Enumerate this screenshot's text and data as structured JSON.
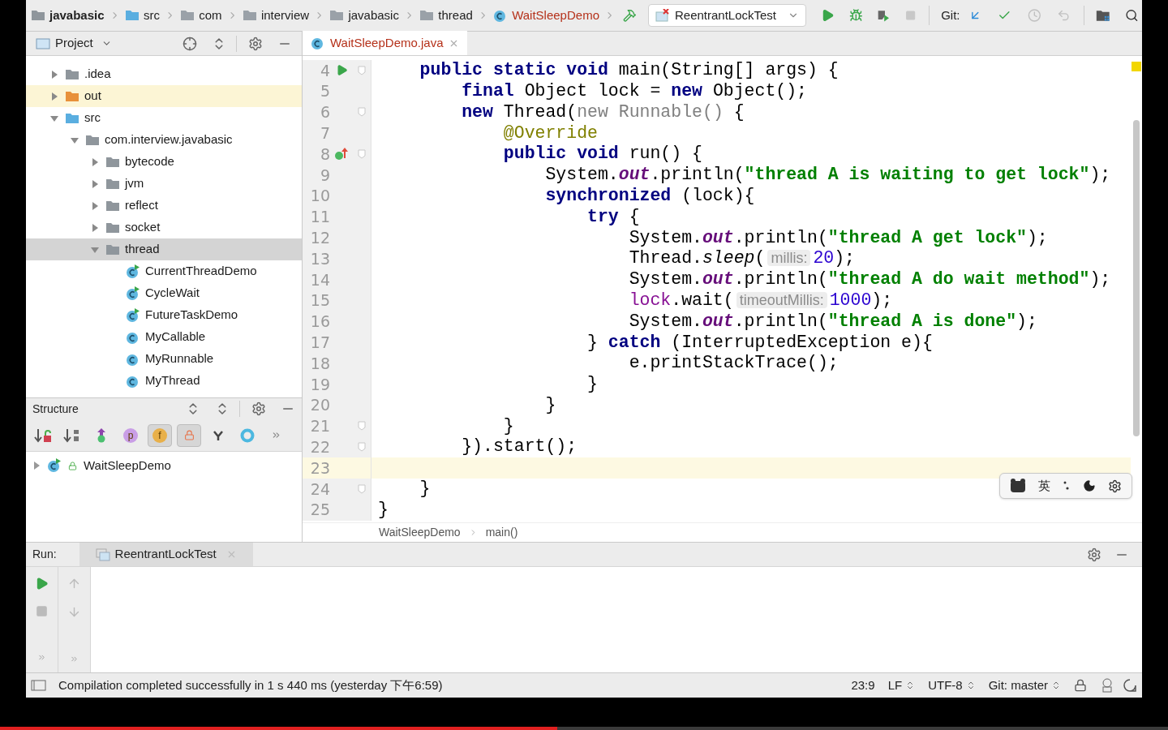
{
  "nav_bar": {
    "breadcrumbs": [
      {
        "label": "javabasic",
        "kind": "module"
      },
      {
        "label": "src",
        "kind": "source"
      },
      {
        "label": "com",
        "kind": "package"
      },
      {
        "label": "interview",
        "kind": "package"
      },
      {
        "label": "javabasic",
        "kind": "package"
      },
      {
        "label": "thread",
        "kind": "package"
      },
      {
        "label": "WaitSleepDemo",
        "kind": "class"
      }
    ],
    "run_config": "ReentrantLockTest",
    "git_label": "Git:"
  },
  "project_panel": {
    "title": "Project",
    "tree": [
      {
        "label": ".idea",
        "kind": "folder",
        "color": "#8f969c",
        "expanded": false,
        "selected": false,
        "excluded": false
      },
      {
        "label": "out",
        "kind": "folder",
        "color": "#e8913a",
        "expanded": false,
        "selected": false,
        "excluded": true
      },
      {
        "label": "src",
        "kind": "folder",
        "color": "#5aaee0",
        "expanded": true,
        "selected": false,
        "excluded": false,
        "children": [
          {
            "label": "com.interview.javabasic",
            "kind": "folder",
            "color": "#8f969c",
            "expanded": true,
            "selected": false,
            "excluded": false,
            "children": [
              {
                "label": "bytecode",
                "kind": "folder",
                "color": "#8f969c",
                "expanded": false,
                "selected": false,
                "excluded": false
              },
              {
                "label": "jvm",
                "kind": "folder",
                "color": "#8f969c",
                "expanded": false,
                "selected": false,
                "excluded": false
              },
              {
                "label": "reflect",
                "kind": "folder",
                "color": "#8f969c",
                "expanded": false,
                "selected": false,
                "excluded": false
              },
              {
                "label": "socket",
                "kind": "folder",
                "color": "#8f969c",
                "expanded": false,
                "selected": false,
                "excluded": false
              },
              {
                "label": "thread",
                "kind": "folder",
                "color": "#8f969c",
                "expanded": true,
                "selected": true,
                "excluded": false,
                "children": [
                  {
                    "label": "CurrentThreadDemo",
                    "kind": "class",
                    "runnable": true,
                    "selected": false,
                    "excluded": false
                  },
                  {
                    "label": "CycleWait",
                    "kind": "class",
                    "runnable": true,
                    "selected": false,
                    "excluded": false
                  },
                  {
                    "label": "FutureTaskDemo",
                    "kind": "class",
                    "runnable": true,
                    "selected": false,
                    "excluded": false
                  },
                  {
                    "label": "MyCallable",
                    "kind": "class",
                    "runnable": false,
                    "selected": false,
                    "excluded": false
                  },
                  {
                    "label": "MyRunnable",
                    "kind": "class",
                    "runnable": false,
                    "selected": false,
                    "excluded": false
                  },
                  {
                    "label": "MyThread",
                    "kind": "class",
                    "runnable": false,
                    "selected": false,
                    "excluded": false
                  }
                ]
              }
            ]
          }
        ]
      }
    ]
  },
  "structure_panel": {
    "title": "Structure",
    "toolbar": [
      {
        "kind": "sort-visibility",
        "selected": false
      },
      {
        "kind": "sort-alpha",
        "selected": false
      },
      {
        "kind": "inherited",
        "selected": false
      },
      {
        "kind": "letter",
        "glyph": "p",
        "color": "#c99ee6",
        "selected": false
      },
      {
        "kind": "letter",
        "glyph": "f",
        "color": "#e8b04a",
        "selected": true
      },
      {
        "kind": "lock",
        "selected": true
      },
      {
        "kind": "lambda",
        "selected": false
      },
      {
        "kind": "ring",
        "selected": false
      }
    ],
    "tree": [
      {
        "label": "WaitSleepDemo",
        "expanded": false
      }
    ]
  },
  "editor": {
    "tab": {
      "label": "WaitSleepDemo.java",
      "selected": true
    },
    "lines": [
      {
        "number": "4",
        "marker": {
          "kind": "run"
        },
        "fold": true,
        "current": false,
        "tokens": [
          {
            "kind": "kw",
            "text": "    public static void"
          },
          {
            "kind": "p",
            "text": " main(String[] args) {"
          }
        ]
      },
      {
        "number": "5",
        "fold": false,
        "current": false,
        "tokens": [
          {
            "kind": "kw",
            "text": "        final"
          },
          {
            "kind": "p",
            "text": " Object lock = "
          },
          {
            "kind": "kw",
            "text": "new"
          },
          {
            "kind": "p",
            "text": " Object();"
          }
        ]
      },
      {
        "number": "6",
        "fold": true,
        "current": false,
        "tokens": [
          {
            "kind": "kw",
            "text": "        new"
          },
          {
            "kind": "p",
            "text": " Thread("
          },
          {
            "kind": "dim",
            "text": "new Runnable()"
          },
          {
            "kind": "p",
            "text": " {"
          }
        ]
      },
      {
        "number": "7",
        "fold": false,
        "current": false,
        "tokens": [
          {
            "kind": "ann",
            "text": "            @Override"
          }
        ]
      },
      {
        "number": "8",
        "marker": {
          "kind": "override"
        },
        "fold": true,
        "current": false,
        "tokens": [
          {
            "kind": "kw",
            "text": "            public void"
          },
          {
            "kind": "p",
            "text": " run() {"
          }
        ]
      },
      {
        "number": "9",
        "fold": false,
        "current": false,
        "tokens": [
          {
            "kind": "p",
            "text": "                System."
          },
          {
            "kind": "fld",
            "text": "out"
          },
          {
            "kind": "p",
            "text": ".println("
          },
          {
            "kind": "str",
            "text": "\"thread A is waiting to get lock\""
          },
          {
            "kind": "p",
            "text": ");"
          }
        ]
      },
      {
        "number": "10",
        "fold": false,
        "current": false,
        "tokens": [
          {
            "kind": "kw",
            "text": "                synchronized"
          },
          {
            "kind": "p",
            "text": " (lock){"
          }
        ]
      },
      {
        "number": "11",
        "fold": false,
        "current": false,
        "tokens": [
          {
            "kind": "kw",
            "text": "                    try"
          },
          {
            "kind": "p",
            "text": " {"
          }
        ]
      },
      {
        "number": "12",
        "fold": false,
        "current": false,
        "tokens": [
          {
            "kind": "p",
            "text": "                        System."
          },
          {
            "kind": "fld",
            "text": "out"
          },
          {
            "kind": "p",
            "text": ".println("
          },
          {
            "kind": "str",
            "text": "\"thread A get lock\""
          },
          {
            "kind": "p",
            "text": ");"
          }
        ]
      },
      {
        "number": "13",
        "fold": false,
        "current": false,
        "tokens": [
          {
            "kind": "p",
            "text": "                        Thread."
          },
          {
            "kind": "it",
            "text": "sleep"
          },
          {
            "kind": "p",
            "text": "("
          },
          {
            "kind": "hint",
            "text": "millis:"
          },
          {
            "kind": "num",
            "text": "20"
          },
          {
            "kind": "p",
            "text": ");"
          }
        ]
      },
      {
        "number": "14",
        "fold": false,
        "current": false,
        "tokens": [
          {
            "kind": "p",
            "text": "                        System."
          },
          {
            "kind": "fld",
            "text": "out"
          },
          {
            "kind": "p",
            "text": ".println("
          },
          {
            "kind": "str",
            "text": "\"thread A do wait method\""
          },
          {
            "kind": "p",
            "text": ");"
          }
        ]
      },
      {
        "number": "15",
        "fold": false,
        "current": false,
        "tokens": [
          {
            "kind": "var",
            "text": "                        lock"
          },
          {
            "kind": "p",
            "text": ".wait("
          },
          {
            "kind": "hint",
            "text": "timeoutMillis:"
          },
          {
            "kind": "num",
            "text": "1000"
          },
          {
            "kind": "p",
            "text": ");"
          }
        ]
      },
      {
        "number": "16",
        "fold": false,
        "current": false,
        "tokens": [
          {
            "kind": "p",
            "text": "                        System."
          },
          {
            "kind": "fld",
            "text": "out"
          },
          {
            "kind": "p",
            "text": ".println("
          },
          {
            "kind": "str",
            "text": "\"thread A is done\""
          },
          {
            "kind": "p",
            "text": ");"
          }
        ]
      },
      {
        "number": "17",
        "fold": false,
        "current": false,
        "tokens": [
          {
            "kind": "p",
            "text": "                    } "
          },
          {
            "kind": "kw",
            "text": "catch"
          },
          {
            "kind": "p",
            "text": " (InterruptedException e){"
          }
        ]
      },
      {
        "number": "18",
        "fold": false,
        "current": false,
        "tokens": [
          {
            "kind": "p",
            "text": "                        e.printStackTrace();"
          }
        ]
      },
      {
        "number": "19",
        "fold": false,
        "current": false,
        "tokens": [
          {
            "kind": "p",
            "text": "                    }"
          }
        ]
      },
      {
        "number": "20",
        "fold": false,
        "current": false,
        "tokens": [
          {
            "kind": "p",
            "text": "                }"
          }
        ]
      },
      {
        "number": "21",
        "fold": true,
        "current": false,
        "tokens": [
          {
            "kind": "p",
            "text": "            }"
          }
        ]
      },
      {
        "number": "22",
        "fold": true,
        "current": false,
        "tokens": [
          {
            "kind": "p",
            "text": "        }).start();"
          }
        ]
      },
      {
        "number": "23",
        "fold": false,
        "current": true
      },
      {
        "number": "24",
        "fold": true,
        "current": false,
        "tokens": [
          {
            "kind": "p",
            "text": "    }"
          }
        ]
      },
      {
        "number": "25",
        "fold": false,
        "current": false,
        "tokens": [
          {
            "kind": "p",
            "text": "}"
          }
        ]
      }
    ],
    "breadcrumbs": [
      "WaitSleepDemo",
      "main()"
    ]
  },
  "ime_toolbar": {
    "label": "英"
  },
  "run_panel": {
    "label": "Run:",
    "tab": {
      "label": "ReentrantLockTest",
      "selected": true
    }
  },
  "status_bar": {
    "message": "Compilation completed successfully in 1 s 440 ms (yesterday 下午6:59)",
    "items": [
      {
        "label": "23:9",
        "dropdown": false
      },
      {
        "label": "LF",
        "dropdown": true
      },
      {
        "label": "UTF-8",
        "dropdown": true
      },
      {
        "label": "Git: master",
        "dropdown": true
      }
    ]
  },
  "video_progress": {
    "level": 0.477
  }
}
